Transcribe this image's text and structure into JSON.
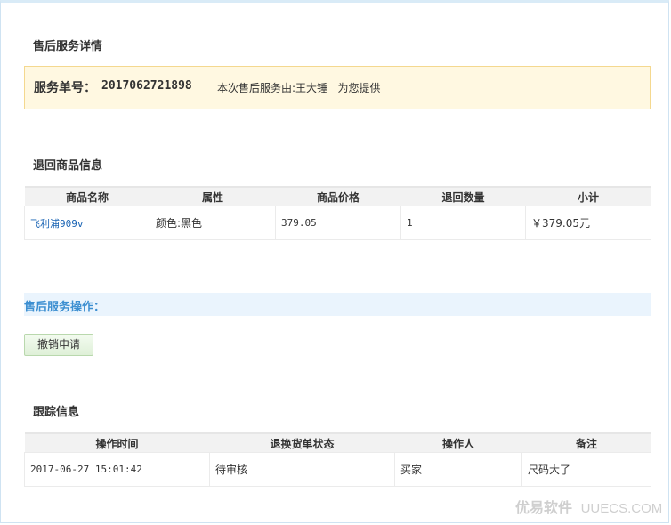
{
  "page": {
    "title": "售后服务详情"
  },
  "service": {
    "number_label": "服务单号：",
    "number_value": "2017062721898",
    "provider_text": "本次售后服务由:王大锤   为您提供"
  },
  "return_goods": {
    "title": "退回商品信息",
    "columns": [
      "商品名称",
      "属性",
      "商品价格",
      "退回数量",
      "小计"
    ],
    "rows": [
      {
        "name": "飞利浦909v",
        "attribute": "颜色:黑色",
        "price": "379.05",
        "quantity": "1",
        "subtotal": "￥379.05元"
      }
    ]
  },
  "operations": {
    "title": "售后服务操作：",
    "cancel_button": "撤销申请"
  },
  "tracking": {
    "title": "跟踪信息",
    "columns": [
      "操作时间",
      "退换货单状态",
      "操作人",
      "备注"
    ],
    "rows": [
      {
        "time": "2017-06-27 15:01:42",
        "status": "待审核",
        "operator": "买家",
        "note": "尺码大了"
      }
    ]
  },
  "watermark": {
    "brand": "优易软件",
    "url": "UUECS.COM"
  },
  "colors": {
    "link": "#1a64b4",
    "section_accent": "#3d8fd1",
    "notice_bg": "#fff8e1",
    "notice_border": "#f4d88f"
  }
}
